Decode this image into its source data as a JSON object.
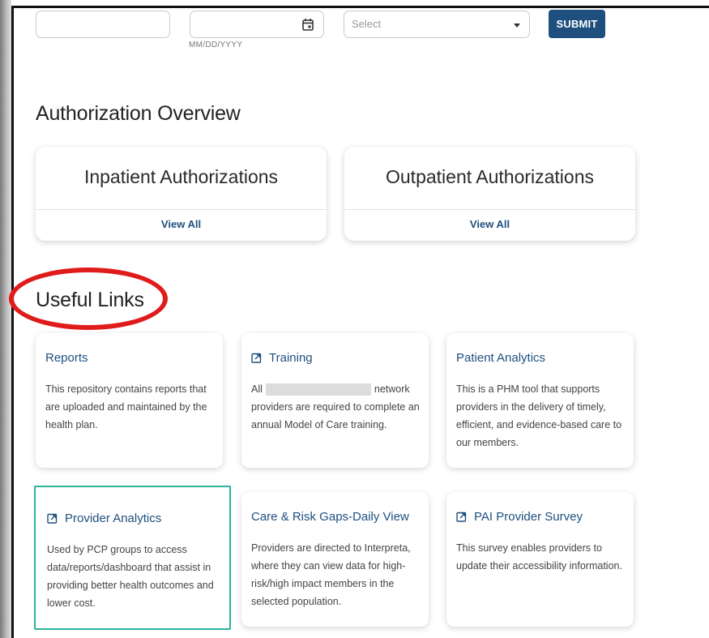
{
  "filters": {
    "field1_value": "",
    "date_value": "",
    "date_hint": "MM/DD/YYYY",
    "select_value": "Select",
    "submit_label": "SUBMIT"
  },
  "authorization": {
    "title": "Authorization Overview",
    "cards": [
      {
        "title": "Inpatient Authorizations",
        "link": "View All"
      },
      {
        "title": "Outpatient Authorizations",
        "link": "View All"
      }
    ]
  },
  "useful_links": {
    "title": "Useful Links",
    "annotation_color": "#e01b1b",
    "cards": [
      {
        "title": "Reports",
        "external": false,
        "description": "This repository contains reports that are uploaded and maintained by the health plan."
      },
      {
        "title": "Training",
        "external": true,
        "description_prefix": "All",
        "description_suffix": "network providers are required to complete an annual Model of Care training."
      },
      {
        "title": "Patient Analytics",
        "external": false,
        "description": "This is a PHM tool that supports providers in the delivery of timely, efficient, and evidence-based care to our members."
      },
      {
        "title": "Provider Analytics",
        "external": true,
        "selected": true,
        "description": "Used by PCP groups to access data/reports/dashboard that assist in providing better health outcomes and lower cost."
      },
      {
        "title": "Care & Risk Gaps-Daily View",
        "external": false,
        "description": "Providers are directed to Interpreta, where they can view data for high-risk/high impact members in the selected population."
      },
      {
        "title": "PAI Provider Survey",
        "external": true,
        "description": "This survey enables providers to update their accessibility information."
      }
    ]
  },
  "colors": {
    "accent": "#1e4f7f",
    "selected_border": "#2bb39b"
  }
}
